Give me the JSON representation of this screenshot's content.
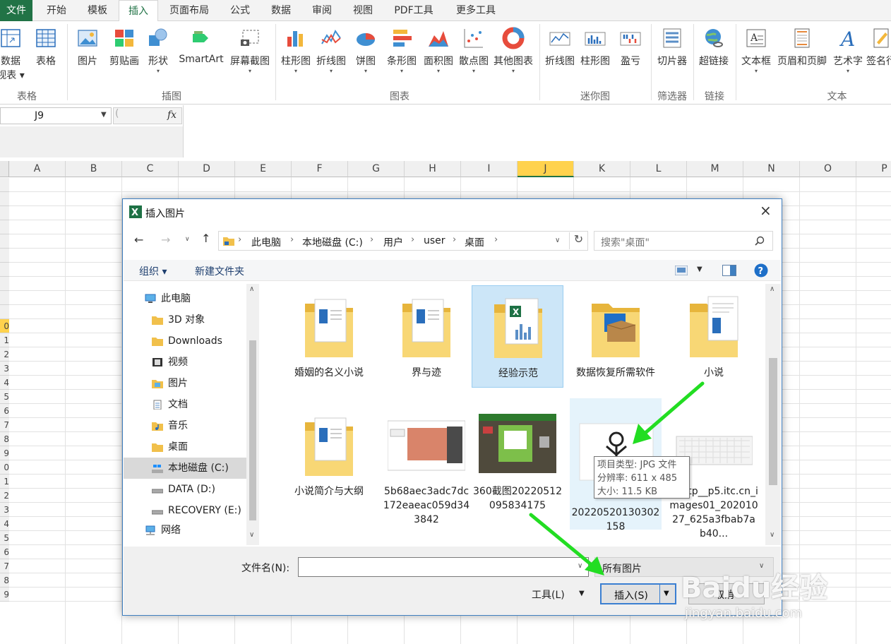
{
  "ribbon_tabs": [
    "文件",
    "开始",
    "模板",
    "插入",
    "页面布局",
    "公式",
    "数据",
    "审阅",
    "视图",
    "PDF工具",
    "更多工具"
  ],
  "ribbon": {
    "buttons": [
      {
        "label": "数据",
        "sub": "视表 ▾"
      },
      {
        "label": "表格"
      },
      {
        "label": "图片"
      },
      {
        "label": "剪贴画"
      },
      {
        "label": "形状"
      },
      {
        "label": "SmartArt"
      },
      {
        "label": "屏幕截图"
      },
      {
        "label": "柱形图"
      },
      {
        "label": "折线图"
      },
      {
        "label": "饼图"
      },
      {
        "label": "条形图"
      },
      {
        "label": "面积图"
      },
      {
        "label": "散点图"
      },
      {
        "label": "其他图表"
      },
      {
        "label": "折线图"
      },
      {
        "label": "柱形图"
      },
      {
        "label": "盈亏"
      },
      {
        "label": "切片器"
      },
      {
        "label": "超链接"
      },
      {
        "label": "文本框"
      },
      {
        "label": "页眉和页脚"
      },
      {
        "label": "艺术字"
      },
      {
        "label": "签名行"
      }
    ],
    "groups": [
      "表格",
      "插图",
      "图表",
      "迷你图",
      "筛选器",
      "链接",
      "文本"
    ]
  },
  "namebox": "J9",
  "fx_symbol": "fx",
  "columns": [
    "A",
    "B",
    "C",
    "D",
    "E",
    "F",
    "G",
    "H",
    "I",
    "J",
    "K",
    "L",
    "M",
    "N",
    "O",
    "P"
  ],
  "selected_column": "J",
  "rows": [
    "",
    "",
    "",
    "",
    "",
    "",
    "",
    "",
    "",
    "",
    "0",
    "1",
    "2",
    "3",
    "4",
    "5",
    "6",
    "7",
    "8",
    "9",
    "0",
    "1",
    "2",
    "3",
    "4",
    "5",
    "6",
    "7",
    "8",
    "9"
  ],
  "selected_row_index": 10,
  "dialog": {
    "title": "插入图片",
    "close": "×",
    "breadcrumb": [
      "此电脑",
      "本地磁盘 (C:)",
      "用户",
      "user",
      "桌面"
    ],
    "search_placeholder": "搜索\"桌面\"",
    "organize": "组织 ▾",
    "new_folder": "新建文件夹",
    "nav": [
      {
        "label": "此电脑",
        "icon": "pc-icon"
      },
      {
        "label": "3D 对象",
        "icon": "folder-icon"
      },
      {
        "label": "Downloads",
        "icon": "folder-icon"
      },
      {
        "label": "视频",
        "icon": "video-folder-icon"
      },
      {
        "label": "图片",
        "icon": "pictures-folder-icon"
      },
      {
        "label": "文档",
        "icon": "documents-folder-icon"
      },
      {
        "label": "音乐",
        "icon": "music-folder-icon"
      },
      {
        "label": "桌面",
        "icon": "folder-icon"
      },
      {
        "label": "本地磁盘 (C:)",
        "icon": "windows-drive-icon"
      },
      {
        "label": "DATA (D:)",
        "icon": "drive-icon"
      },
      {
        "label": "RECOVERY (E:)",
        "icon": "drive-icon"
      },
      {
        "label": "网络",
        "icon": "network-icon"
      }
    ],
    "files": [
      {
        "name": "婚姻的名义小说",
        "kind": "folder"
      },
      {
        "name": "界与迹",
        "kind": "folder"
      },
      {
        "name": "经验示范",
        "kind": "folder-excel"
      },
      {
        "name": "数据恢复所需软件",
        "kind": "folder-box"
      },
      {
        "name": "小说",
        "kind": "folder-doc"
      },
      {
        "name": "小说简介与大纲",
        "kind": "folder"
      },
      {
        "name": "5b68aec3adc7dc172eaeac059d343842",
        "kind": "image-screenshot"
      },
      {
        "name": "360截图20220512095834175",
        "kind": "image-green"
      },
      {
        "name": "20220520130302158",
        "kind": "image-figure"
      },
      {
        "name": "=http__p5.itc.cn_images01_20201027_625a3fbab7ab40...",
        "kind": "image-keyboard"
      }
    ],
    "tooltip": [
      "项目类型: JPG 文件",
      "分辨率: 611 x 485",
      "大小: 11.5 KB"
    ],
    "filename_label": "文件名(N):",
    "filename_value": "",
    "filetype": "所有图片",
    "tools": "工具(L)",
    "insert": "插入(S)",
    "cancel": "取消"
  },
  "watermark": {
    "brand": "Baidu经验",
    "url": "jingyan.baidu.com"
  },
  "colors": {
    "excel_green": "#217346",
    "selection_blue": "#cce6f8",
    "arrow_green": "#22dd22",
    "header_highlight": "#ffd24d"
  }
}
